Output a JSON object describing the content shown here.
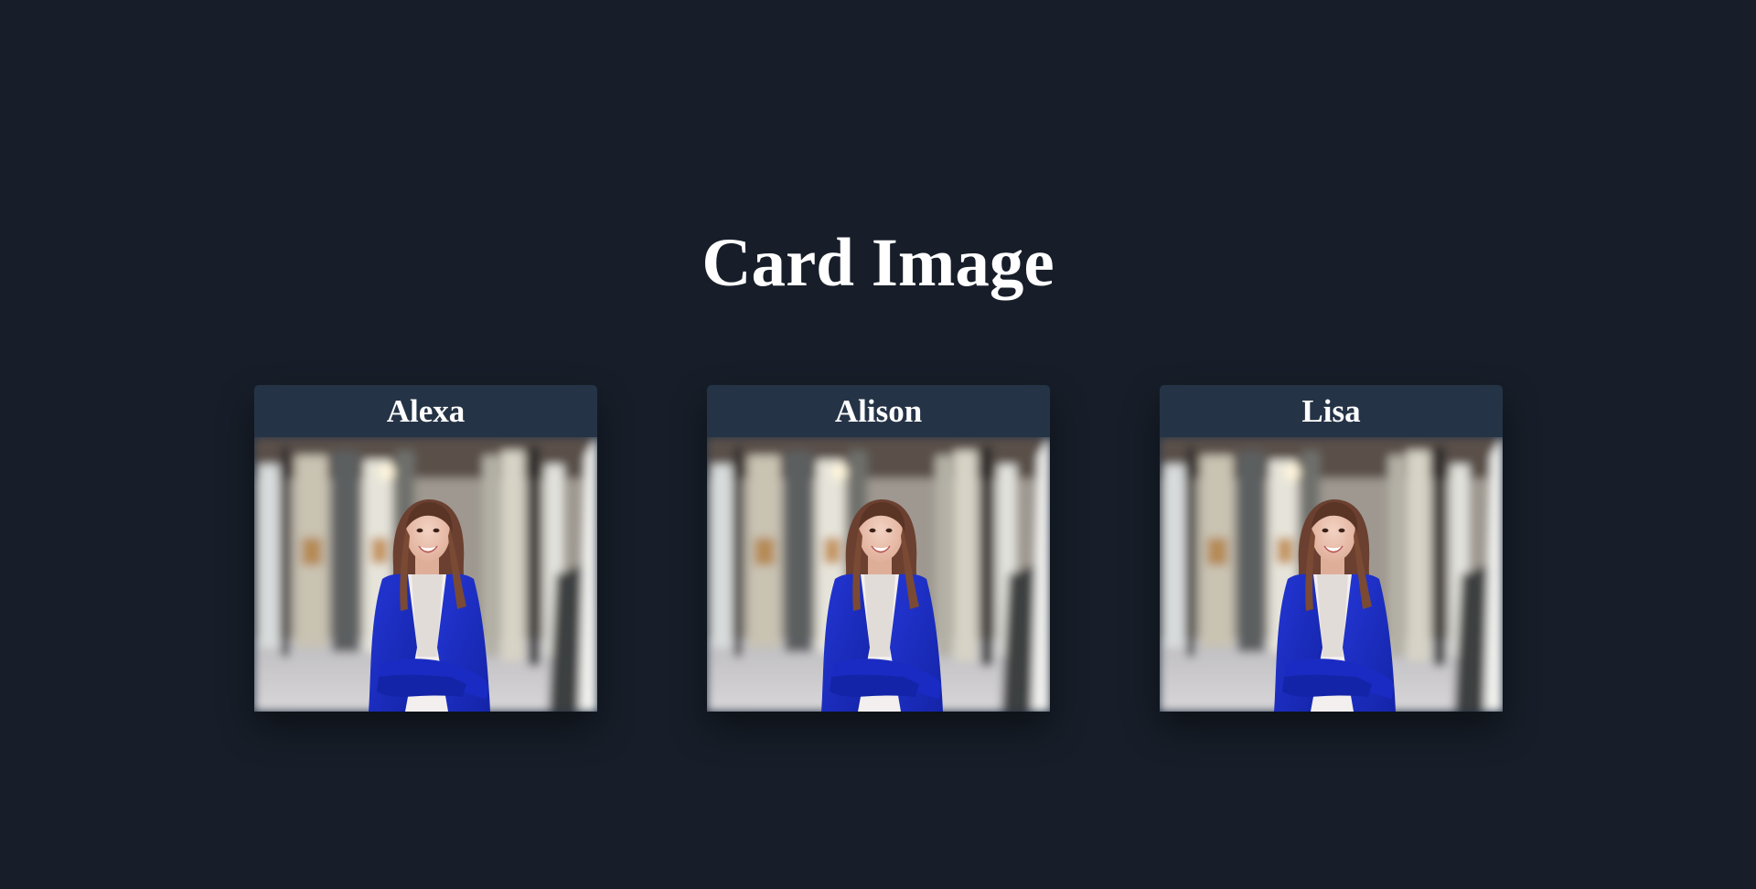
{
  "page": {
    "title": "Card Image",
    "background": "#171e29"
  },
  "cards": [
    {
      "name": "Alexa"
    },
    {
      "name": "Alison"
    },
    {
      "name": "Lisa"
    }
  ],
  "colors": {
    "card_header": "#253346",
    "jacket": "#1a2bc4",
    "text": "#ffffff"
  }
}
